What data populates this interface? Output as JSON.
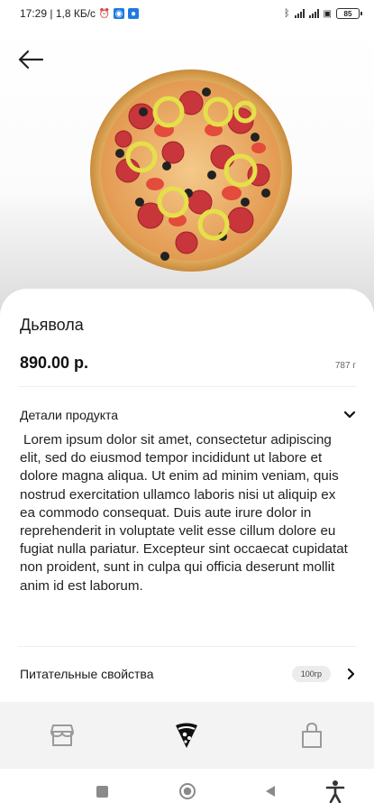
{
  "status_bar": {
    "time_speed": "17:29 | 1,8 КБ/с",
    "battery": "85"
  },
  "product": {
    "name": "Дьявола",
    "price": "890.00 р.",
    "weight": "787 г"
  },
  "details": {
    "label": "Детали продукта",
    "text": "Lorem ipsum dolor sit amet, consectetur adipiscing elit, sed do eiusmod tempor incididunt ut labore et dolore magna aliqua. Ut enim ad minim veniam, quis nostrud exercitation ullamco laboris nisi ut aliquip ex ea commodo consequat. Duis aute irure dolor in reprehenderit in voluptate velit esse cillum dolore eu fugiat nulla pariatur. Excepteur sint occaecat cupidatat non proident, sunt in culpa qui officia deserunt mollit anim id est laborum."
  },
  "nutrition": {
    "label": "Питательные свойства",
    "badge": "100гр"
  },
  "bottom_nav": [
    {
      "icon": "store-icon",
      "active": false
    },
    {
      "icon": "pizza-slice-icon",
      "active": true
    },
    {
      "icon": "shopping-bag-icon",
      "active": false
    }
  ],
  "colors": {
    "accent": "#111111",
    "inactive_icon": "#9a9a9a",
    "nav_background": "#f3f3f3"
  }
}
